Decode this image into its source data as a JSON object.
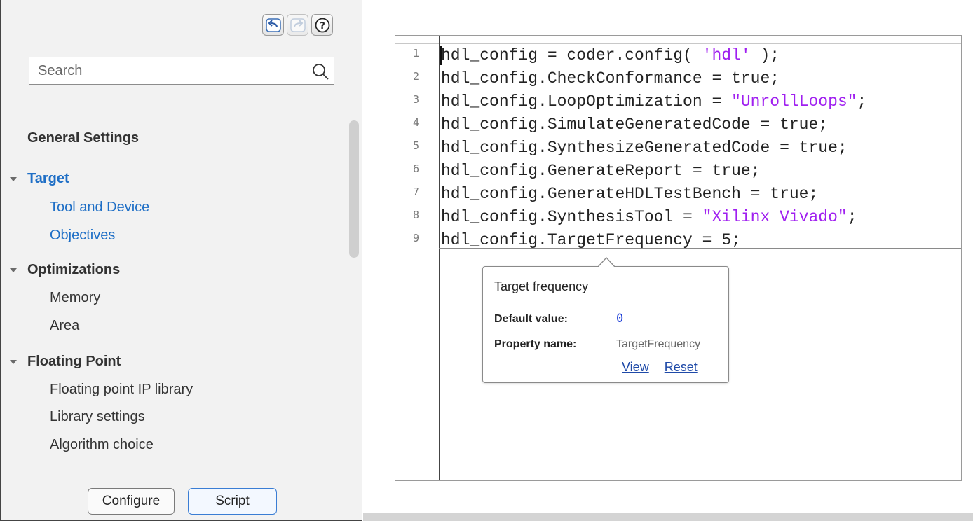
{
  "toolbar": {
    "undo_icon": "undo-icon",
    "redo_icon": "redo-icon",
    "help_icon": "help-icon"
  },
  "search": {
    "placeholder": "Search",
    "value": ""
  },
  "nav": {
    "general": "General Settings",
    "target": "Target",
    "tool_and_device": "Tool and Device",
    "objectives": "Objectives",
    "optimizations": "Optimizations",
    "memory": "Memory",
    "area": "Area",
    "floating_point": "Floating Point",
    "floating_point_ip_library": "Floating point IP library",
    "library_settings": "Library settings",
    "algorithm_choice": "Algorithm choice"
  },
  "buttons": {
    "configure": "Configure",
    "script": "Script"
  },
  "code": {
    "lines": [
      {
        "num": "1",
        "pre": "hdl_config = coder.config( ",
        "str": "'hdl'",
        "post": " );"
      },
      {
        "num": "2",
        "pre": "hdl_config.CheckConformance = true;",
        "str": "",
        "post": ""
      },
      {
        "num": "3",
        "pre": "hdl_config.LoopOptimization = ",
        "str": "\"UnrollLoops\"",
        "post": ";"
      },
      {
        "num": "4",
        "pre": "hdl_config.SimulateGeneratedCode = true;",
        "str": "",
        "post": ""
      },
      {
        "num": "5",
        "pre": "hdl_config.SynthesizeGeneratedCode = true;",
        "str": "",
        "post": ""
      },
      {
        "num": "6",
        "pre": "hdl_config.GenerateReport = true;",
        "str": "",
        "post": ""
      },
      {
        "num": "7",
        "pre": "hdl_config.GenerateHDLTestBench = true;",
        "str": "",
        "post": ""
      },
      {
        "num": "8",
        "pre": "hdl_config.SynthesisTool = ",
        "str": "\"Xilinx Vivado\"",
        "post": ";"
      },
      {
        "num": "9",
        "pre": "hdl_config.TargetFrequency = 5;",
        "str": "",
        "post": ""
      }
    ]
  },
  "popup": {
    "title": "Target frequency",
    "default_label": "Default value:",
    "default_value": "0",
    "property_label": "Property name:",
    "property_value": "TargetFrequency",
    "view": "View",
    "reset": "Reset"
  },
  "colors": {
    "accent": "#1f6fc6",
    "string": "#a020f0",
    "number": "#1a3cd6"
  }
}
